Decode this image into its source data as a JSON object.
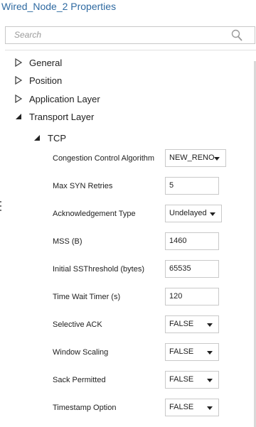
{
  "window": {
    "title": "Wired_Node_2 Properties"
  },
  "search": {
    "placeholder": "Search",
    "icon": "search-icon"
  },
  "tree": {
    "general": "General",
    "position": "Position",
    "application_layer": "Application Layer",
    "transport_layer": "Transport Layer",
    "tcp": "TCP"
  },
  "tcp_properties": [
    {
      "label": "Congestion Control Algorithm",
      "value": "NEW_RENO",
      "type": "dropdown"
    },
    {
      "label": "Max SYN Retries",
      "value": "5",
      "type": "text"
    },
    {
      "label": "Acknowledgement Type",
      "value": "Undelayed",
      "type": "dropdown"
    },
    {
      "label": "MSS (B)",
      "value": "1460",
      "type": "text"
    },
    {
      "label": "Initial SSThreshold (bytes)",
      "value": "65535",
      "type": "text"
    },
    {
      "label": "Time Wait Timer (s)",
      "value": "120",
      "type": "text"
    },
    {
      "label": "Selective ACK",
      "value": "FALSE",
      "type": "dropdown"
    },
    {
      "label": "Window Scaling",
      "value": "FALSE",
      "type": "dropdown"
    },
    {
      "label": "Sack Permitted",
      "value": "FALSE",
      "type": "dropdown"
    },
    {
      "label": "Timestamp Option",
      "value": "FALSE",
      "type": "dropdown"
    }
  ],
  "colors": {
    "title": "#2f6aa1",
    "border": "#c9c9c9",
    "text": "#1e1e1e"
  }
}
